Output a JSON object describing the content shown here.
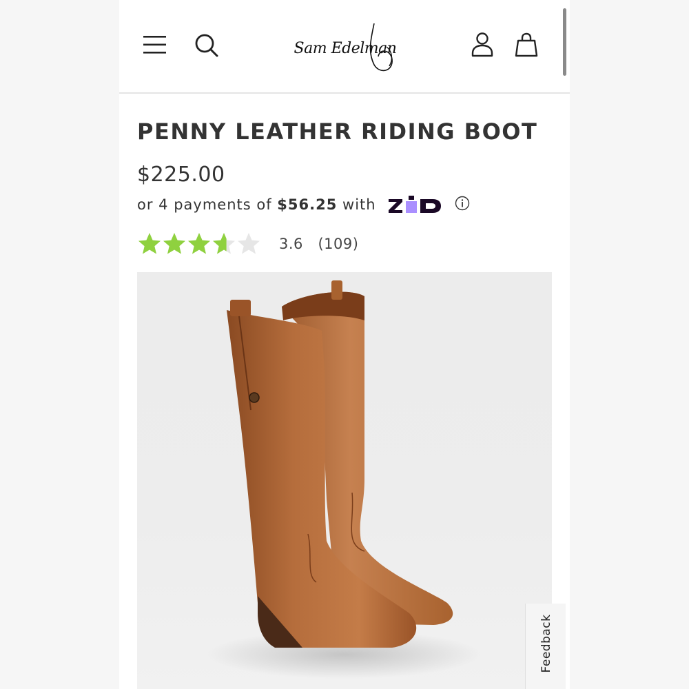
{
  "header": {
    "menu_icon": "hamburger-menu-icon",
    "search_icon": "search-icon",
    "logo_text": "Sam Edelman",
    "account_icon": "user-icon",
    "cart_icon": "shopping-bag-icon"
  },
  "product": {
    "title": "PENNY LEATHER RIDING BOOT",
    "price": "$225.00",
    "installments": {
      "prefix": "or 4 payments of",
      "amount": "$56.25",
      "suffix": "with",
      "provider_logo": "Zip",
      "provider_brand_colors": {
        "text": "#1a0826",
        "accent": "#aa8fff"
      },
      "info_icon": "info-icon"
    },
    "rating": {
      "value": 3.6,
      "max": 5,
      "count": "(109)",
      "display": "3.6",
      "star_color": "#8fd13f",
      "empty_star_color": "#e6e6e6"
    },
    "image_alt_subject": "brown leather riding boots"
  },
  "feedback": {
    "label": "Feedback"
  }
}
